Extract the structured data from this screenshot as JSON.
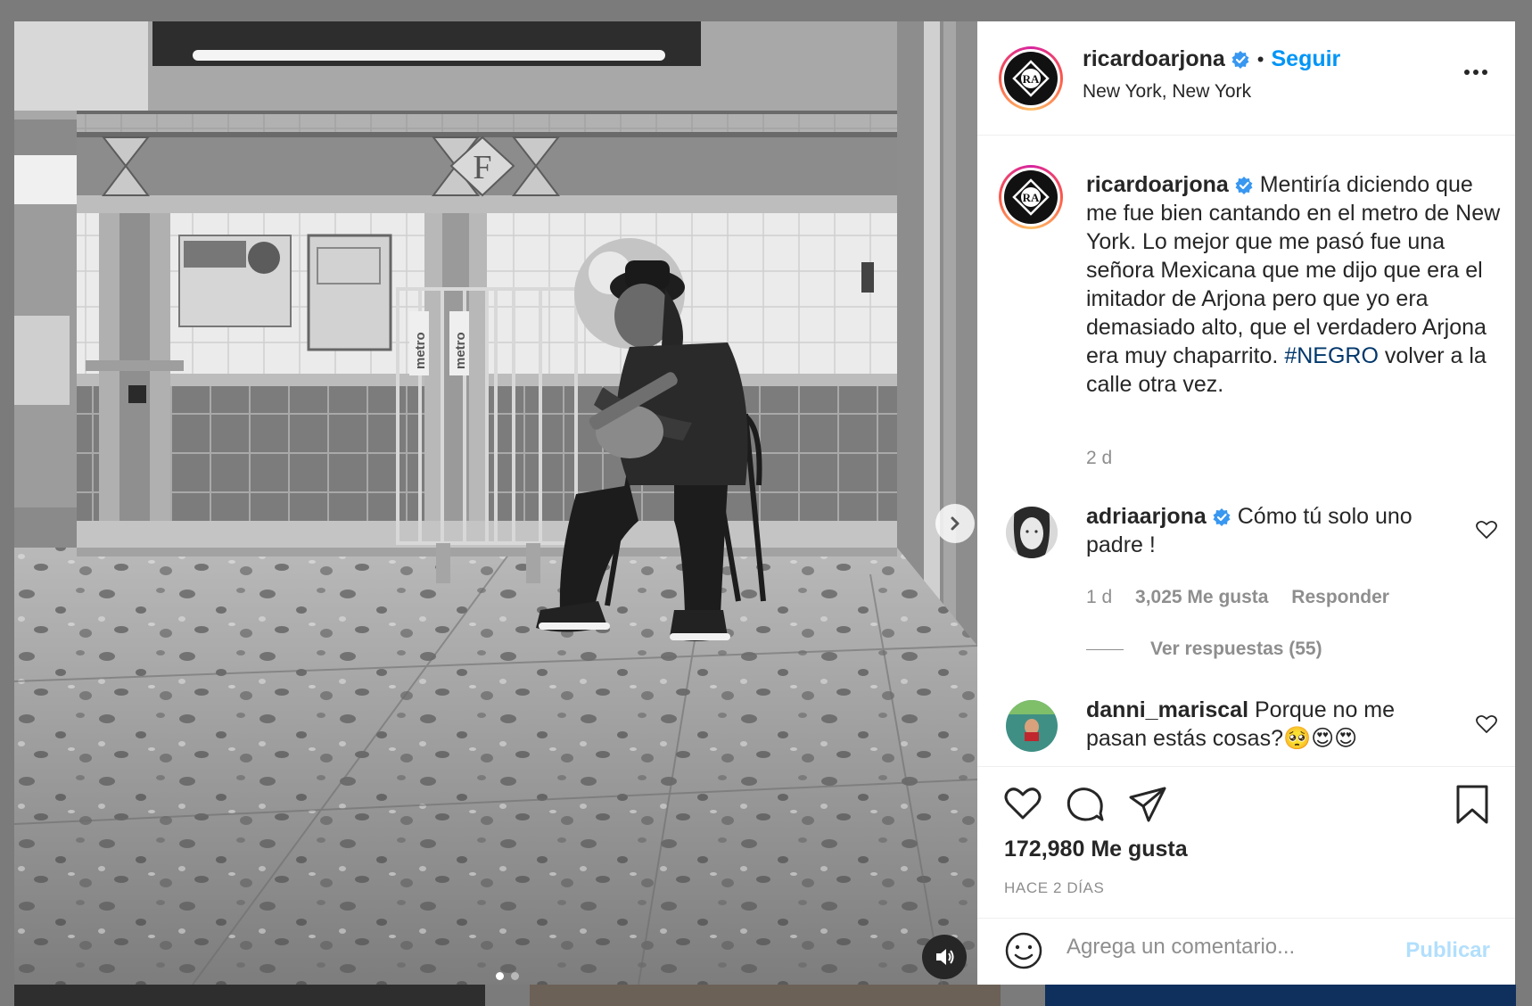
{
  "post": {
    "username": "ricardoarjona",
    "follow_label": "Seguir",
    "separator": "•",
    "location": "New York, New York",
    "avatar_text": "RA",
    "photo_sign_letter": "F",
    "photo_bin_label": "metro",
    "carousel": {
      "count": 2,
      "active_index": 0
    }
  },
  "caption": {
    "username": "ricardoarjona",
    "text": "Mentiría diciendo que me fue bien cantando en el metro de New York. Lo mejor que me pasó fue una señora Mexicana que me dijo que era el imitador de Arjona pero que yo era demasiado alto, que el verdadero Arjona era muy chaparrito.",
    "hashtag": "#NEGRO",
    "text_after": "volver a la calle otra vez.",
    "time": "2 d"
  },
  "comments": [
    {
      "username": "adriaarjona",
      "verified": true,
      "text": "Cómo tú solo uno padre !",
      "time": "1 d",
      "likes": "3,025 Me gusta",
      "reply": "Responder",
      "view_replies": "Ver respuestas (55)"
    },
    {
      "username": "danni_mariscal",
      "verified": false,
      "text": "Porque no me pasan estás cosas?🥺😍😍"
    }
  ],
  "actions": {
    "like_count": "172,980 Me gusta",
    "time_ago": "HACE 2 DÍAS",
    "comment_placeholder": "Agrega un comentario...",
    "publish_label": "Publicar"
  },
  "colors": {
    "link": "#0095f6",
    "hashtag": "#00376b",
    "verified": "#3897f0",
    "muted": "#8e8e8e",
    "publish_disabled": "#b2dffc",
    "overlay": "#7b7b7b"
  },
  "icons": [
    "verified-badge-icon",
    "more-options-icon",
    "chevron-right-icon",
    "volume-icon",
    "heart-icon",
    "comment-icon",
    "share-icon",
    "bookmark-icon",
    "emoji-icon",
    "heart-small-icon"
  ]
}
